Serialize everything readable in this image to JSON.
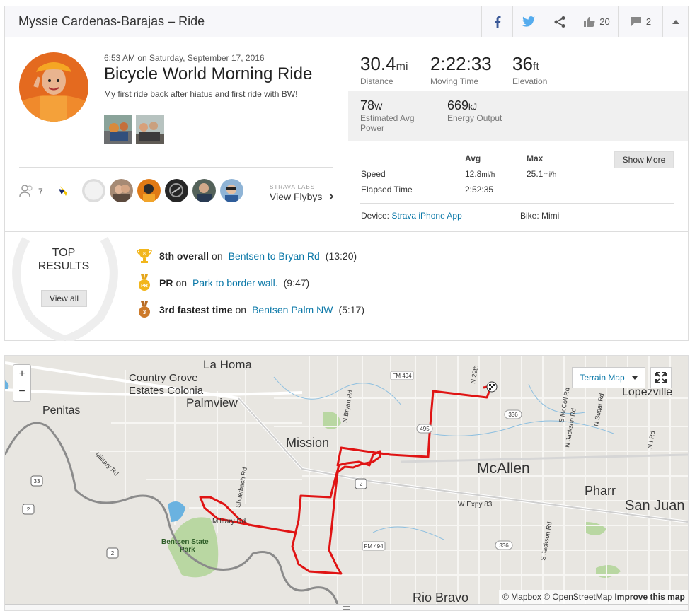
{
  "header": {
    "title": "Myssie Cardenas-Barajas – Ride",
    "kudos_count": "20",
    "comment_count": "2"
  },
  "activity": {
    "date": "6:53 AM on Saturday, September 17, 2016",
    "title": "Bicycle World Morning Ride",
    "description": "My first ride back after hiatus and first ride with BW!",
    "photo_count": 2
  },
  "social": {
    "kudos_people": "7",
    "strava_labs": "STRAVA LABS",
    "view_flybys": "View Flybys"
  },
  "stats": {
    "distance": {
      "value": "30.4",
      "unit": "mi",
      "label": "Distance"
    },
    "moving_time": {
      "value": "2:22:33",
      "label": "Moving Time"
    },
    "elevation": {
      "value": "36",
      "unit": "ft",
      "label": "Elevation"
    },
    "power": {
      "value": "78",
      "unit": "W",
      "label_1": "Estimated Avg",
      "label_2": "Power"
    },
    "energy": {
      "value": "669",
      "unit": "kJ",
      "label": "Energy Output"
    }
  },
  "details": {
    "avg_header": "Avg",
    "max_header": "Max",
    "speed_label": "Speed",
    "speed_avg": "12.8",
    "speed_max": "25.1",
    "speed_unit": "mi/h",
    "elapsed_label": "Elapsed Time",
    "elapsed_avg": "2:52:35",
    "show_more": "Show More",
    "device_label": "Device:",
    "device_value": "Strava iPhone App",
    "bike": "Bike: Mimi"
  },
  "results": {
    "title_1": "TOP",
    "title_2": "RESULTS",
    "view_all": "View all",
    "items": [
      {
        "rank": "8th overall",
        "on": "on",
        "segment": "Bentsen to Bryan Rd",
        "time": "(13:20)",
        "medal_text": "8",
        "medal_color": "#f2b61c"
      },
      {
        "rank": "PR",
        "on": "on",
        "segment": "Park to border wall.",
        "time": "(9:47)",
        "medal_text": "PR",
        "medal_color": "#f2b61c"
      },
      {
        "rank": "3rd fastest time",
        "on": "on",
        "segment": "Bentsen Palm NW",
        "time": "(5:17)",
        "medal_text": "3",
        "medal_color": "#cd7a2a"
      }
    ]
  },
  "map": {
    "zoom_in": "+",
    "zoom_out": "−",
    "map_type": "Terrain Map",
    "attribution_1": "© Mapbox",
    "attribution_2": "© OpenStreetMap",
    "attribution_3": "Improve this map",
    "places": {
      "la_homa": "La Homa",
      "country_grove_1": "Country Grove",
      "country_grove_2": "Estates Colonia",
      "palmview": "Palmview",
      "penitas": "Penitas",
      "mission": "Mission",
      "mcallen": "McAllen",
      "pharr": "Pharr",
      "san_juan": "San Juan",
      "lopezville": "Lopezville",
      "rio_bravo": "Rio Bravo",
      "bentsen_1": "Bentsen State",
      "bentsen_2": "Park",
      "military_rd": "Military Rd",
      "military_rd2": "Military Rd",
      "fm494": "FM 494",
      "fm494b": "FM 494",
      "hwy336": "336",
      "hwy336b": "336",
      "hwy495": "495",
      "hwy2": "2",
      "hwy2b": "2",
      "hwy2c": "2",
      "hwy33": "33",
      "w_expy": "W Expy 83",
      "n_bryan": "N Bryan Rd",
      "shuerbach": "Shuerbach Rd",
      "n_29th": "N 29th",
      "s_mccoll": "S McColl Rd",
      "s_jackson": "S Jackson Rd",
      "n_jackson": "N Jackson Rd",
      "n_sugar": "N Sugar Rd",
      "n_i_rd": "N I Rd",
      "s_jackson2": "S Jackson Rd"
    }
  }
}
